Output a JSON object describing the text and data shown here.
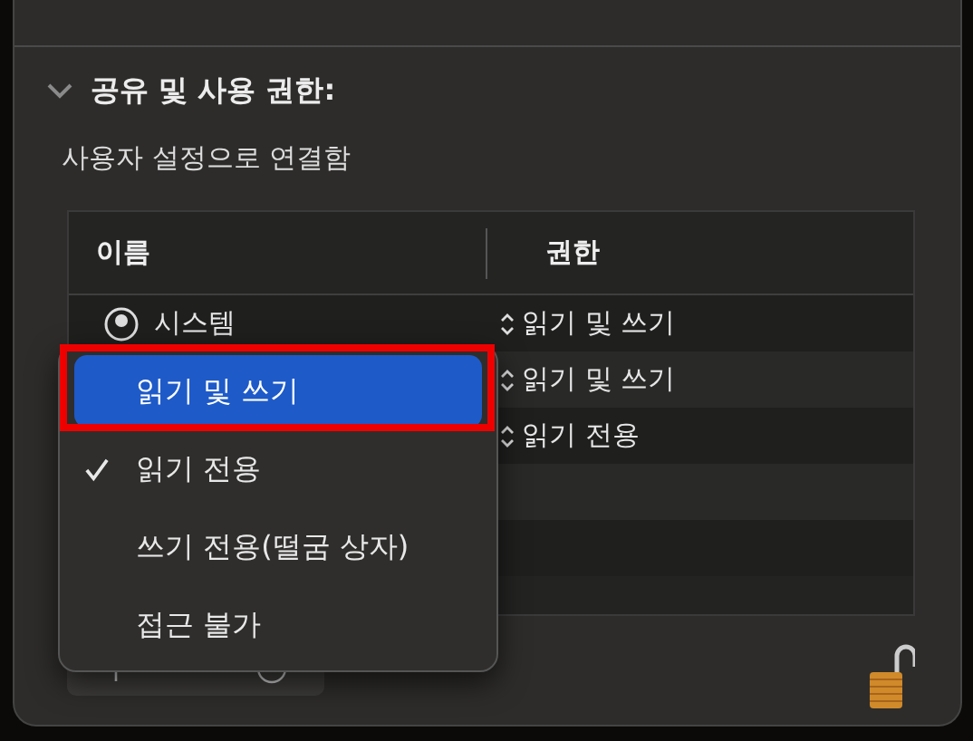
{
  "section": {
    "title": "공유 및 사용 권한:",
    "expanded": true
  },
  "subtitle": "사용자 설정으로 연결함",
  "table": {
    "columns": [
      "이름",
      "권한"
    ],
    "rows": [
      {
        "name": "시스템",
        "permission": "읽기 및 쓰기"
      },
      {
        "permission": "읽기 및 쓰기"
      },
      {
        "permission": "읽기 전용"
      }
    ]
  },
  "menu": {
    "items": [
      {
        "label": "읽기 및 쓰기",
        "selected": true,
        "checked": false
      },
      {
        "label": "읽기 전용",
        "selected": false,
        "checked": true
      },
      {
        "label": "쓰기 전용(떨굼 상자)",
        "selected": false,
        "checked": false
      },
      {
        "label": "접근 불가",
        "selected": false,
        "checked": false
      }
    ]
  },
  "lock": {
    "locked": false
  }
}
